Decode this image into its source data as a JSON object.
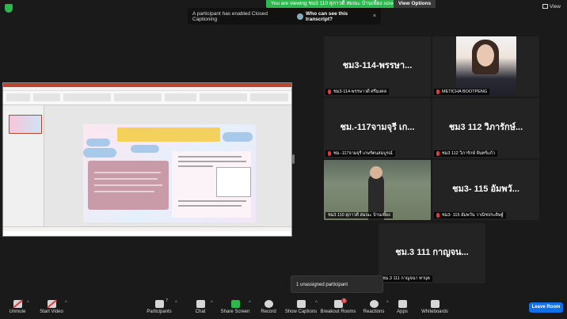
{
  "topbar": {
    "viewing_banner": "You are viewing ชม3 110 สุภาวดี สมณะ บ้านเพี้ยง screen",
    "view_options": "View Options",
    "view": "View"
  },
  "notice": {
    "message": "A participant has enabled Closed Captioning",
    "who_can_see": "Who can see this transcript?",
    "close": "×"
  },
  "tiles": [
    {
      "big": "ชม3-114-พรรษา...",
      "caption": "ชม3-114-พรรษาวดี ศรีมงคล"
    },
    {
      "big": "",
      "caption": "METICHA BOOTPENG"
    },
    {
      "big": "ชม.-117จามจุรี เก...",
      "caption": "ชม.-117จามจุรี เกษรัตนสมบูรณ์"
    },
    {
      "big": "ชม3 112 วิภารักษ์...",
      "caption": "ชม3 112 วิภารักษ์ จันทร์แก้ว"
    },
    {
      "big": "",
      "caption": "ชม3 110 สุภาวดี สมณะ บ้านเพี้ยง"
    },
    {
      "big": "ชม3- 115 อัมพวั...",
      "caption": "ชม3- 115 อัมพวัน วาณิชประดิษฐ์"
    },
    {
      "big": "ชม.3 111 กาญจน...",
      "caption": "ชม.3 111 กาญจนา ทาบุต"
    }
  ],
  "popup": {
    "unassigned": "1 unassigned participant"
  },
  "toolbar": {
    "unmute": "Unmute",
    "start_video": "Start Video",
    "participants": "Participants",
    "participants_count": "7",
    "chat": "Chat",
    "share_screen": "Share Screen",
    "record": "Record",
    "show_captions": "Show Captions",
    "breakout_rooms": "Breakout Rooms",
    "breakout_badge": "1",
    "reactions": "Reactions",
    "apps": "Apps",
    "whiteboards": "Whiteboards",
    "leave": "Leave Room"
  },
  "icons": {
    "mic": "mic-muted-icon",
    "video": "video-off-icon",
    "participants": "people-icon",
    "chat": "chat-icon",
    "share": "share-screen-icon",
    "record": "record-icon",
    "captions": "cc-icon",
    "breakout": "breakout-rooms-icon",
    "reactions": "emoji-icon",
    "apps": "apps-icon",
    "whiteboards": "whiteboard-icon",
    "security": "shield-icon"
  },
  "colors": {
    "accent_green": "#2db84d",
    "leave_blue": "#0e71eb",
    "active_speaker": "#e9e46a",
    "muted_red": "#e03b3b"
  }
}
